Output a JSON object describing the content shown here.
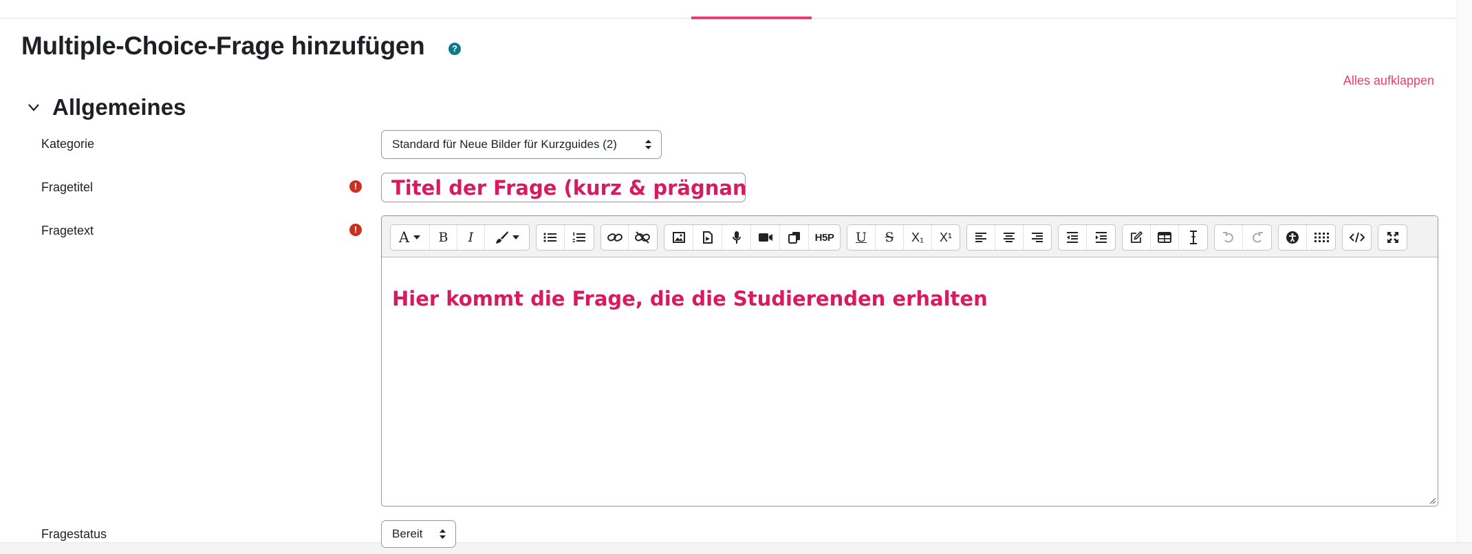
{
  "page": {
    "title": "Multiple-Choice-Frage hinzufügen",
    "help_glyph": "?",
    "expand_all": "Alles aufklappen"
  },
  "section": {
    "title": "Allgemeines"
  },
  "fields": {
    "category": {
      "label": "Kategorie",
      "value": "Standard für Neue Bilder für Kurzguides (2)"
    },
    "question_title": {
      "label": "Fragetitel",
      "value": "Titel der Frage (kurz & prägnant)",
      "required_glyph": "!"
    },
    "question_text": {
      "label": "Fragetext",
      "required_glyph": "!",
      "content": "Hier kommt die Frage, die die Studierenden erhalten"
    },
    "status": {
      "label": "Fragestatus",
      "value": "Bereit"
    }
  },
  "toolbar": {
    "font_glyph": "A",
    "bold_glyph": "B",
    "italic_glyph": "I",
    "h5p_label": "H5P",
    "underline_glyph": "U",
    "strike_glyph": "S",
    "subscript_glyph": "X₁",
    "superscript_glyph": "X¹"
  },
  "colors": {
    "accent": "#e83e6c",
    "handwritten_pink": "#d81b60",
    "required": "#ca3120",
    "help": "#0d7a8c"
  }
}
